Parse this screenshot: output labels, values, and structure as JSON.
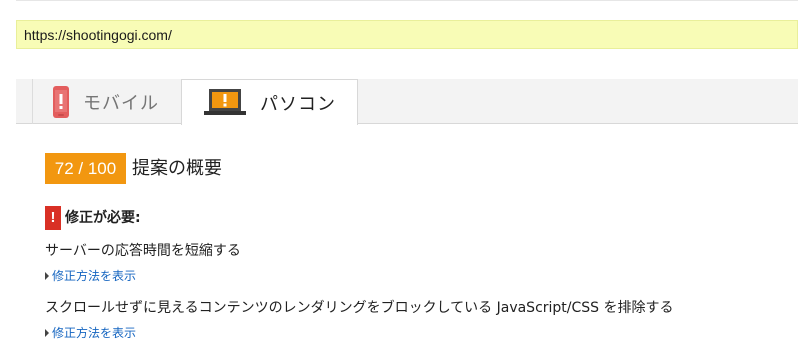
{
  "url_field": {
    "value": "https://shootingogi.com/"
  },
  "tabs": [
    {
      "label": "モバイル",
      "icon": "phone-warning-icon",
      "selected": false
    },
    {
      "label": "パソコン",
      "icon": "laptop-warning-icon",
      "selected": true
    }
  ],
  "summary": {
    "score": "72 / 100",
    "title": "提案の概要"
  },
  "must_fix": {
    "icon_glyph": "!",
    "heading": "修正が必要:",
    "rules": [
      {
        "title": "サーバーの応答時間を短縮する",
        "link": "修正方法を表示"
      },
      {
        "title": "スクロールせずに見えるコンテンツのレンダリングをブロックしている JavaScript/CSS を排除する",
        "link": "修正方法を表示"
      }
    ]
  },
  "colors": {
    "url_bar_bg": "#f8fcb6",
    "score_bg": "#f29710",
    "alert_red": "#d93025",
    "link_blue": "#1565c0"
  }
}
